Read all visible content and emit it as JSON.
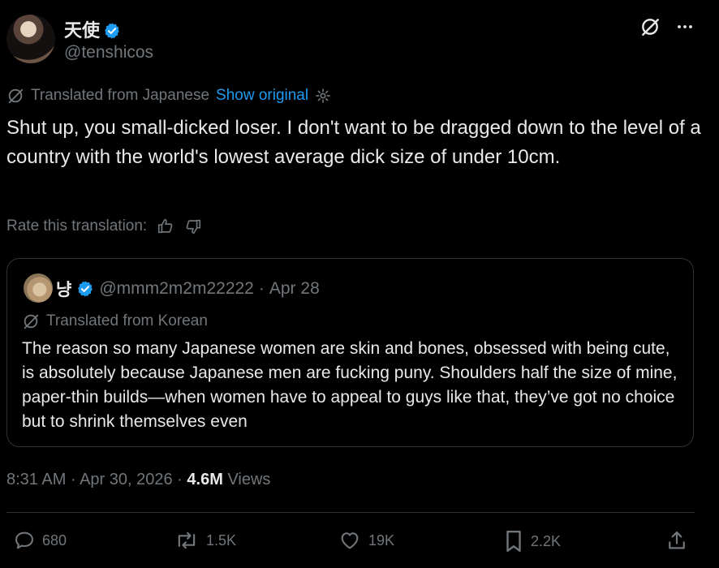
{
  "author": {
    "display_name": "天使",
    "handle": "@tenshicos",
    "verified_color": "#1d9bf0"
  },
  "translation": {
    "label": "Translated from Japanese",
    "show_original": "Show original"
  },
  "tweet": {
    "text": "Shut up, you small-dicked loser. I don't want to be dragged down to the level of a country with the world's lowest average dick size of under 10cm."
  },
  "rate": {
    "label": "Rate this translation:"
  },
  "quote": {
    "display_name": "냥",
    "handle": "@mmm2m2m22222",
    "separator": "·",
    "date": "Apr 28",
    "translated_label": "Translated from Korean",
    "text": "The reason so many Japanese women are skin and bones, obsessed with being cute, is absolutely because Japanese men are fucking puny. Shoulders half the size of mine, paper-thin builds—when women have to appeal to guys like that, they’ve got no choice but to shrink themselves even"
  },
  "meta": {
    "time": "8:31 AM",
    "separator1": "·",
    "date": "Apr 30, 2026",
    "separator2": "·",
    "views_count": "4.6M",
    "views_label": "Views"
  },
  "actions": {
    "replies": "680",
    "reposts": "1.5K",
    "likes": "19K",
    "bookmarks": "2.2K"
  },
  "colors": {
    "background": "#000000",
    "text": "#e7e9ea",
    "secondary": "#71767b",
    "accent": "#1d9bf0",
    "border": "#2f3336"
  }
}
